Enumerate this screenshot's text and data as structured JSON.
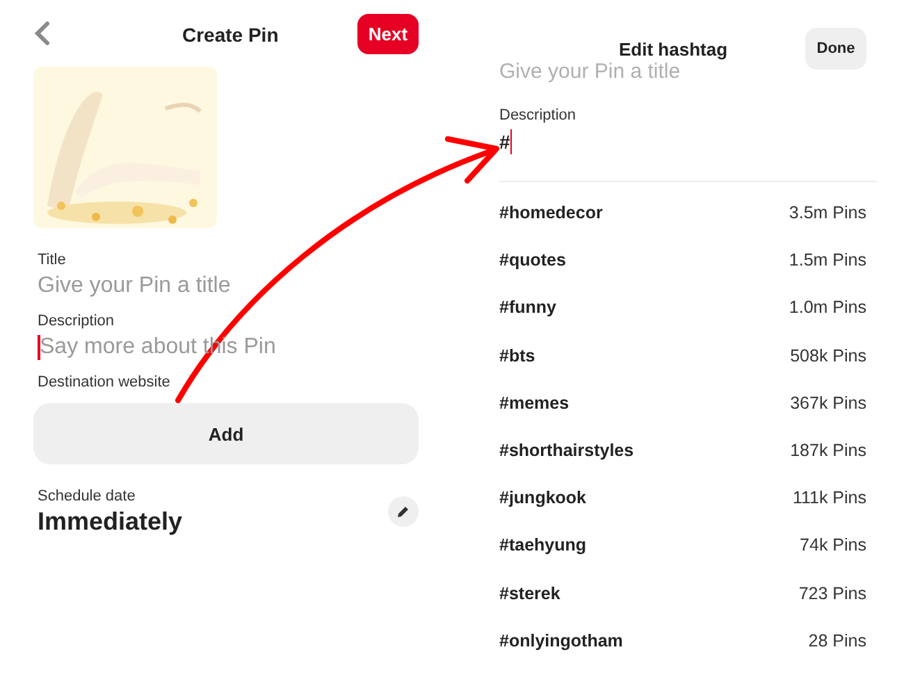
{
  "create_pin": {
    "title": "Create Pin",
    "next_button": "Next",
    "title_field": {
      "label": "Title",
      "placeholder": "Give your Pin a title"
    },
    "description_field": {
      "label": "Description",
      "placeholder": "Say more about this Pin",
      "focused": true
    },
    "destination": {
      "label": "Destination website",
      "button": "Add"
    },
    "schedule": {
      "label": "Schedule date",
      "value": "Immediately"
    }
  },
  "edit_hashtag": {
    "title": "Edit hashtag",
    "done_button": "Done",
    "background_title": "Give your Pin a title",
    "description": {
      "label": "Description",
      "value": "#",
      "focused": true
    },
    "suggestions": [
      {
        "tag": "#homedecor",
        "count": "3.5m Pins"
      },
      {
        "tag": "#quotes",
        "count": "1.5m Pins"
      },
      {
        "tag": "#funny",
        "count": "1.0m Pins"
      },
      {
        "tag": "#bts",
        "count": "508k Pins"
      },
      {
        "tag": "#memes",
        "count": "367k Pins"
      },
      {
        "tag": "#shorthairstyles",
        "count": "187k Pins"
      },
      {
        "tag": "#jungkook",
        "count": "111k Pins"
      },
      {
        "tag": "#taehyung",
        "count": "74k Pins"
      },
      {
        "tag": "#sterek",
        "count": "723 Pins"
      },
      {
        "tag": "#onlyingotham",
        "count": "28 Pins"
      }
    ]
  }
}
